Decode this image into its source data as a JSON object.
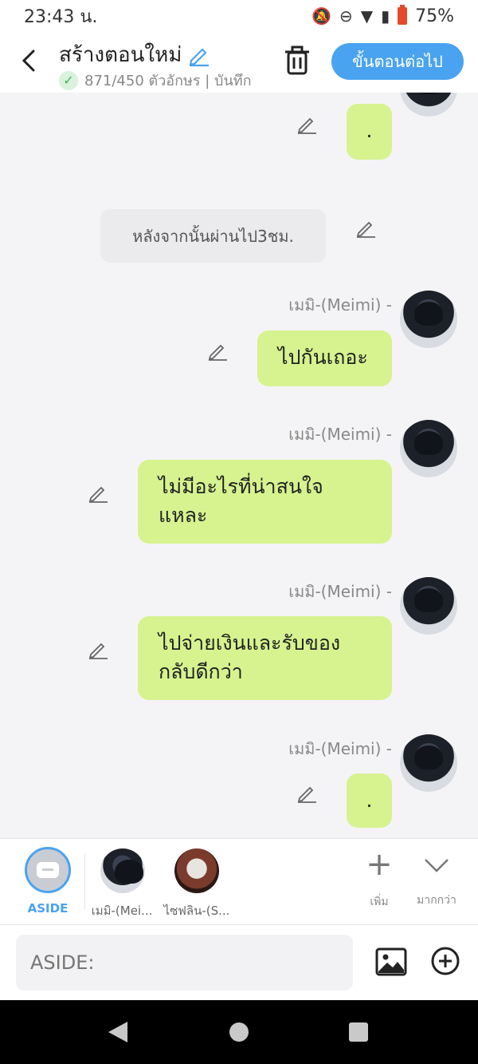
{
  "status": {
    "time": "23:43 น.",
    "battery": "75%"
  },
  "header": {
    "title": "สร้างตอนใหม่",
    "char_count": "871/450 ตัวอักษร | บันทึก",
    "next_label": "ขั้นตอนต่อไป"
  },
  "chat": {
    "narration": "หลังจากนั้นผ่านไป3ชม.",
    "messages": [
      {
        "speaker": "",
        "text": "."
      },
      {
        "speaker": "เมมิ-(Meimi) -",
        "text": "ไปกันเถอะ"
      },
      {
        "speaker": "เมมิ-(Meimi) -",
        "line1": "ไม่มีอะไรที่น่าสนใจ",
        "line2": "แหละ"
      },
      {
        "speaker": "เมมิ-(Meimi) -",
        "line1": "ไปจ่ายเงินและรับของ",
        "line2": "กลับดีกว่า"
      },
      {
        "speaker": "เมมิ-(Meimi) -",
        "text": "."
      }
    ]
  },
  "characters": {
    "aside_label": "ASIDE",
    "char1": "เมมิ-(Mei...",
    "char2": "ไซฟลิน-(S...",
    "add_label": "เพิ่ม",
    "more_label": "มากกว่า"
  },
  "input": {
    "placeholder": "ASIDE:"
  }
}
